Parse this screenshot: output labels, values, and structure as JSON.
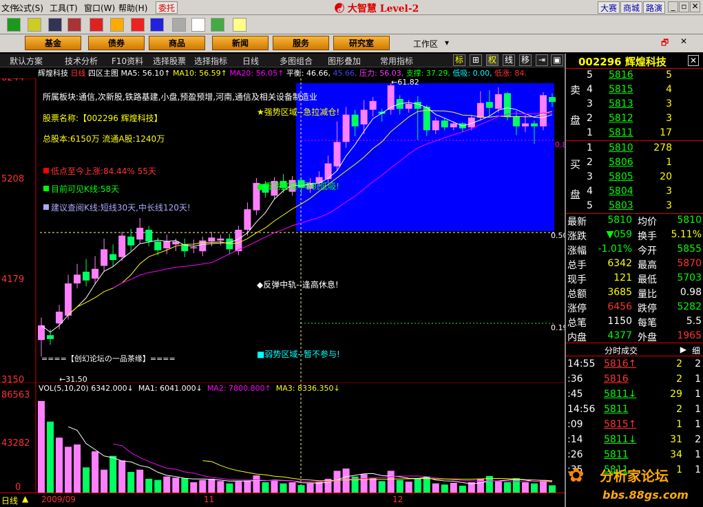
{
  "menu": [
    "文件",
    "公式(S)",
    "工具(T)",
    "窗口(W)",
    "帮助(H)"
  ],
  "menu_tag": "委托",
  "app_title": "大智慧 Level-2",
  "right_btns": [
    "大赛",
    "商城",
    "路演"
  ],
  "nav": [
    "基金",
    "债券",
    "商品",
    "新闻",
    "服务",
    "研究室"
  ],
  "workspace": "工作区",
  "funcbar": [
    "默认方案",
    "技术分析",
    "F10资料",
    "选择股票",
    "选择指标",
    "日线",
    "多图组合",
    "图形叠加",
    "常用指标"
  ],
  "funcbar_sq": [
    "标",
    "⊞",
    "权",
    "线",
    "移",
    "⇥",
    "▣"
  ],
  "chart_info": {
    "name": "辉煌科技",
    "period": "日线",
    "main": "四区主图",
    "ma5": "MA5: 56.10↑",
    "ma10": "MA10: 56.59↑",
    "ma20": "MA20: 56.05↑",
    "pingheng": "平衡: 46.66,",
    "v2": "45.66,",
    "yali": "压力: 56.03,",
    "zhicheng": "支撑: 37.29,",
    "dixi": "低吸: 0.00,",
    "dizhang": "低涨: 84."
  },
  "overlay": {
    "l1": "所属板块:通信,次新股,铁路基建,小盘,预盈预增,河南,通信及相关设备制造业",
    "l2": "股票名称:【002296 辉煌科技】",
    "l3": "总股本:6150万    流通A股:1240万",
    "l4": "低点至今上涨:84.44%    55天",
    "l5": "目前可见K线:58天",
    "l6": "建议查阅K线:短线30天,中长线120天!",
    "zone1": "★强势区域--急拉减仓!",
    "zone2": "●震荡整理--寻机低吸!",
    "zone3": "◆反弹中轨--逢高休息!",
    "zone4": "■弱势区域--暂不参与!",
    "forum": "====【创幻论坛の一品茶缘】====",
    "hi": "61.82",
    "lo": "31.50",
    "r080": "0.80",
    "r050": "0.50",
    "r019": "0.19"
  },
  "y_labels": [
    "6244",
    "5208",
    "4179",
    "3150"
  ],
  "vol_labels": [
    "86563",
    "43282",
    "0"
  ],
  "vol_info": {
    "t1": "VOL(5,10,20)",
    "v": "6342.000↓",
    "ma1": "MA1: 6041.000↓",
    "ma2": "MA2: 7800.800↑",
    "ma3": "MA3: 8336.350↓"
  },
  "x_labels": [
    "2009/09",
    "11",
    "12"
  ],
  "bottom_left": "日线",
  "colors": {
    "up": "#ff80ff",
    "down": "#00ff60",
    "ma5": "#ffffff",
    "ma10": "#ffff00",
    "ma20": "#ff00ff",
    "blue": "#0000ff"
  },
  "rp": {
    "code": "002296 辉煌科技",
    "sell_label": [
      "卖",
      "盘"
    ],
    "buy_label": [
      "买",
      "盘"
    ],
    "sells": [
      {
        "l": "5",
        "p": "5816",
        "v": "5"
      },
      {
        "l": "4",
        "p": "5815",
        "v": "4"
      },
      {
        "l": "3",
        "p": "5813",
        "v": "3"
      },
      {
        "l": "2",
        "p": "5812",
        "v": "3"
      },
      {
        "l": "1",
        "p": "5811",
        "v": "17"
      }
    ],
    "buys": [
      {
        "l": "1",
        "p": "5810",
        "v": "278"
      },
      {
        "l": "2",
        "p": "5806",
        "v": "1"
      },
      {
        "l": "3",
        "p": "5805",
        "v": "20"
      },
      {
        "l": "4",
        "p": "5804",
        "v": "3"
      },
      {
        "l": "5",
        "p": "5803",
        "v": "3"
      }
    ],
    "stats": [
      {
        "a": "最新",
        "av": "5810",
        "b": "均价",
        "bv": "5810",
        "ac": "#0f0",
        "bc": "#0f0"
      },
      {
        "a": "涨跌",
        "av": "▼059",
        "b": "换手",
        "bv": "5.11%",
        "ac": "#0f0",
        "bc": "#ff0"
      },
      {
        "a": "涨幅",
        "av": "-1.01%",
        "b": "今开",
        "bv": "5855",
        "ac": "#0f0",
        "bc": "#0f0"
      },
      {
        "a": "总手",
        "av": "6342",
        "b": "最高",
        "bv": "5870",
        "ac": "#ff0",
        "bc": "#f33"
      },
      {
        "a": "现手",
        "av": "121",
        "b": "最低",
        "bv": "5703",
        "ac": "#ff0",
        "bc": "#0f0"
      },
      {
        "a": "总额",
        "av": "3685",
        "b": "量比",
        "bv": "0.98",
        "ac": "#ff0",
        "bc": "#fff"
      },
      {
        "a": "涨停",
        "av": "6456",
        "b": "跌停",
        "bv": "5282",
        "ac": "#f33",
        "bc": "#0f0"
      },
      {
        "a": "总笔",
        "av": "1150",
        "b": "每笔",
        "bv": "5.5",
        "ac": "#fff",
        "bc": "#fff"
      },
      {
        "a": "内盘",
        "av": "4377",
        "b": "外盘",
        "bv": "1965",
        "ac": "#0f0",
        "bc": "#f33"
      }
    ],
    "tick_head": "分时成交",
    "tick_tab": "细",
    "ticks": [
      {
        "t": "14:55",
        "p": "5816↑",
        "v": "2",
        "n": "2",
        "c": "#f33"
      },
      {
        "t": ":36",
        "p": "5816",
        "v": "2",
        "n": "1",
        "c": "#f33"
      },
      {
        "t": ":45",
        "p": "5811↓",
        "v": "29",
        "n": "1",
        "c": "#0f0"
      },
      {
        "t": "14:56",
        "p": "5811",
        "v": "2",
        "n": "1",
        "c": "#0f0"
      },
      {
        "t": ":09",
        "p": "5815↑",
        "v": "1",
        "n": "1",
        "c": "#f33"
      },
      {
        "t": ":14",
        "p": "5811↓",
        "v": "31",
        "n": "2",
        "c": "#0f0"
      },
      {
        "t": ":26",
        "p": "5811",
        "v": "34",
        "n": "1",
        "c": "#0f0"
      },
      {
        "t": ":35",
        "p": "5811",
        "v": "1",
        "n": "1",
        "c": "#0f0"
      }
    ],
    "watermark": "分析家论坛",
    "watermark_url": "bbs.88gs.com"
  },
  "chart_data": {
    "type": "candlestick",
    "title": "辉煌科技 日线",
    "ylim": [
      31.5,
      61.82
    ],
    "candles": [
      [
        35.5,
        37.0,
        33.8,
        37.8
      ],
      [
        36.0,
        35.6,
        35.0,
        36.6
      ],
      [
        37.2,
        38.4,
        36.6,
        39.1
      ],
      [
        38.0,
        41.3,
        37.6,
        42.2
      ],
      [
        41.3,
        42.2,
        40.8,
        43.3
      ],
      [
        42.5,
        41.6,
        41.0,
        43.8
      ],
      [
        41.8,
        42.8,
        41.2,
        44.1
      ],
      [
        43.1,
        44.8,
        42.5,
        45.9
      ],
      [
        44.3,
        43.7,
        43.0,
        45.3
      ],
      [
        44.0,
        46.2,
        43.6,
        46.6
      ],
      [
        46.1,
        45.2,
        44.6,
        46.9
      ],
      [
        45.8,
        47.0,
        45.4,
        48.0
      ],
      [
        46.8,
        45.6,
        45.1,
        47.2
      ],
      [
        45.6,
        44.7,
        44.2,
        46.0
      ],
      [
        44.9,
        45.6,
        44.3,
        46.3
      ],
      [
        45.3,
        45.6,
        44.6,
        45.9
      ],
      [
        45.3,
        44.6,
        44.0,
        45.9
      ],
      [
        44.9,
        45.0,
        44.4,
        45.8
      ],
      [
        44.6,
        45.7,
        44.1,
        46.1
      ],
      [
        45.6,
        46.0,
        45.1,
        46.6
      ],
      [
        45.7,
        45.9,
        45.2,
        46.3
      ],
      [
        45.9,
        44.8,
        44.3,
        46.4
      ],
      [
        44.6,
        46.8,
        44.2,
        47.2
      ],
      [
        46.8,
        48.9,
        46.2,
        49.6
      ],
      [
        48.8,
        51.6,
        48.3,
        52.1
      ],
      [
        51.5,
        50.6,
        50.1,
        51.8
      ],
      [
        50.3,
        51.8,
        49.9,
        52.2
      ],
      [
        51.8,
        51.1,
        50.6,
        52.5
      ],
      [
        50.7,
        51.9,
        50.3,
        52.3
      ],
      [
        51.9,
        51.1,
        50.5,
        52.2
      ],
      [
        51.0,
        51.6,
        50.6,
        52.1
      ],
      [
        51.6,
        52.2,
        51.2,
        52.8
      ],
      [
        52.0,
        53.6,
        51.6,
        54.4
      ],
      [
        53.3,
        55.8,
        52.8,
        57.9
      ],
      [
        55.8,
        58.6,
        55.2,
        59.4
      ],
      [
        58.6,
        57.4,
        56.4,
        59.1
      ],
      [
        57.6,
        59.1,
        56.6,
        60.1
      ],
      [
        59.1,
        60.0,
        58.4,
        60.4
      ],
      [
        58.9,
        58.7,
        57.9,
        59.2
      ],
      [
        59.1,
        61.6,
        58.6,
        61.8
      ],
      [
        60.2,
        59.2,
        58.6,
        60.6
      ],
      [
        59.2,
        59.7,
        58.8,
        60.1
      ],
      [
        59.9,
        59.2,
        56.0,
        60.5
      ],
      [
        59.4,
        57.0,
        56.4,
        59.6
      ],
      [
        57.0,
        58.0,
        56.6,
        58.3
      ],
      [
        58.0,
        57.3,
        57.0,
        58.3
      ],
      [
        57.3,
        57.7,
        57.0,
        57.9
      ],
      [
        57.7,
        57.2,
        56.8,
        57.8
      ],
      [
        57.3,
        58.3,
        57.0,
        58.5
      ],
      [
        58.3,
        59.8,
        58.0,
        61.0
      ],
      [
        59.9,
        59.3,
        58.5,
        61.1
      ],
      [
        59.2,
        60.7,
        58.8,
        61.4
      ],
      [
        60.8,
        58.4,
        58.0,
        60.9
      ],
      [
        58.4,
        57.4,
        56.5,
        59.0
      ],
      [
        57.4,
        57.7,
        56.8,
        58.6
      ],
      [
        57.7,
        57.4,
        55.6,
        58.0
      ],
      [
        57.4,
        60.6,
        57.0,
        60.9
      ],
      [
        60.4,
        59.9,
        59.4,
        60.8
      ]
    ],
    "volumes": [
      80000,
      62000,
      48000,
      40000,
      42000,
      22000,
      36000,
      20000,
      32000,
      28000,
      18000,
      20000,
      12000,
      11000,
      14000,
      13000,
      12500,
      9000,
      11000,
      12000,
      10000,
      8000,
      9500,
      10500,
      15000,
      9000,
      10500,
      8000,
      9000,
      6500,
      8000,
      9500,
      12000,
      19000,
      21000,
      14000,
      16000,
      13000,
      10000,
      19000,
      11000,
      9500,
      12500,
      14000,
      8000,
      7000,
      8500,
      6000,
      9000,
      12000,
      14500,
      10000,
      9000,
      12500,
      9000,
      8000,
      11000,
      6342
    ]
  }
}
